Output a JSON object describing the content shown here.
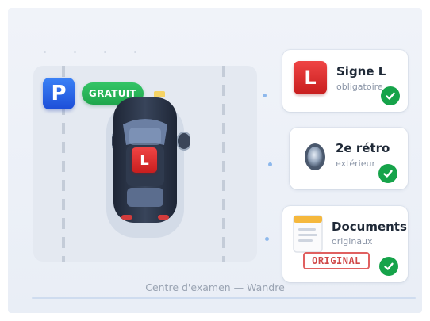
{
  "scene": {
    "parking_sign": "P",
    "free_badge": "GRATUIT",
    "car_sign": "L",
    "caption": "Centre d'examen — Wandre"
  },
  "cards": [
    {
      "title": "Signe L",
      "subtitle": "obligatoire",
      "icon": "l-sign-icon",
      "badge": "L",
      "checked": true
    },
    {
      "title": "2e rétro",
      "subtitle": "extérieur",
      "icon": "mirror-icon",
      "checked": true
    },
    {
      "title": "Documents",
      "subtitle": "originaux",
      "icon": "document-icon",
      "stamp": "ORIGINAL",
      "checked": true
    }
  ],
  "colors": {
    "check": "#16a34a",
    "l_sign": "#dc2626",
    "parking": "#2563eb",
    "gratuit": "#22b455",
    "car_body": "#2b3547"
  }
}
